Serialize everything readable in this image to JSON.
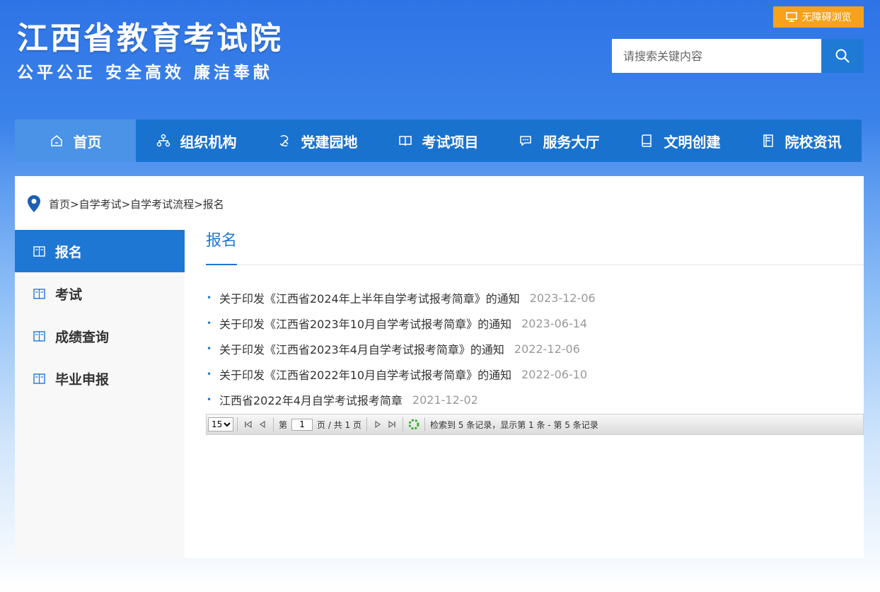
{
  "header": {
    "site_title": "江西省教育考试院",
    "slogan": "公平公正  安全高效  廉洁奉献",
    "access_label": "无障碍浏览",
    "search_placeholder": "请搜索关键内容"
  },
  "nav": {
    "items": [
      {
        "label": "首页",
        "icon": "home-icon"
      },
      {
        "label": "组织机构",
        "icon": "org-chart-icon"
      },
      {
        "label": "党建园地",
        "icon": "party-icon"
      },
      {
        "label": "考试项目",
        "icon": "book-open-icon"
      },
      {
        "label": "服务大厅",
        "icon": "chat-icon"
      },
      {
        "label": "文明创建",
        "icon": "notebook-icon"
      },
      {
        "label": "院校资讯",
        "icon": "document-icon"
      }
    ]
  },
  "breadcrumb": {
    "text": "首页>自学考试>自学考试流程>报名"
  },
  "sidebar": {
    "items": [
      {
        "label": "报名"
      },
      {
        "label": "考试"
      },
      {
        "label": "成绩查询"
      },
      {
        "label": "毕业申报"
      }
    ]
  },
  "content": {
    "title": "报名",
    "news": [
      {
        "title": "关于印发《江西省2024年上半年自学考试报考简章》的通知",
        "date": "2023-12-06"
      },
      {
        "title": "关于印发《江西省2023年10月自学考试报考简章》的通知",
        "date": "2023-06-14"
      },
      {
        "title": "关于印发《江西省2023年4月自学考试报考简章》的通知",
        "date": "2022-12-06"
      },
      {
        "title": "关于印发《江西省2022年10月自学考试报考简章》的通知",
        "date": "2022-06-10"
      },
      {
        "title": "江西省2022年4月自学考试报考简章",
        "date": "2021-12-02"
      }
    ]
  },
  "pager": {
    "page_size": "15",
    "page_prefix": "第",
    "current_page": "1",
    "page_suffix": "页 / 共 1 页",
    "summary": "检索到 5 条记录，显示第 1 条 - 第 5 条记录"
  },
  "colors": {
    "nav_bg": "#1a72cf",
    "accent": "#1f77d4",
    "access_orange": "#f6a21a"
  }
}
